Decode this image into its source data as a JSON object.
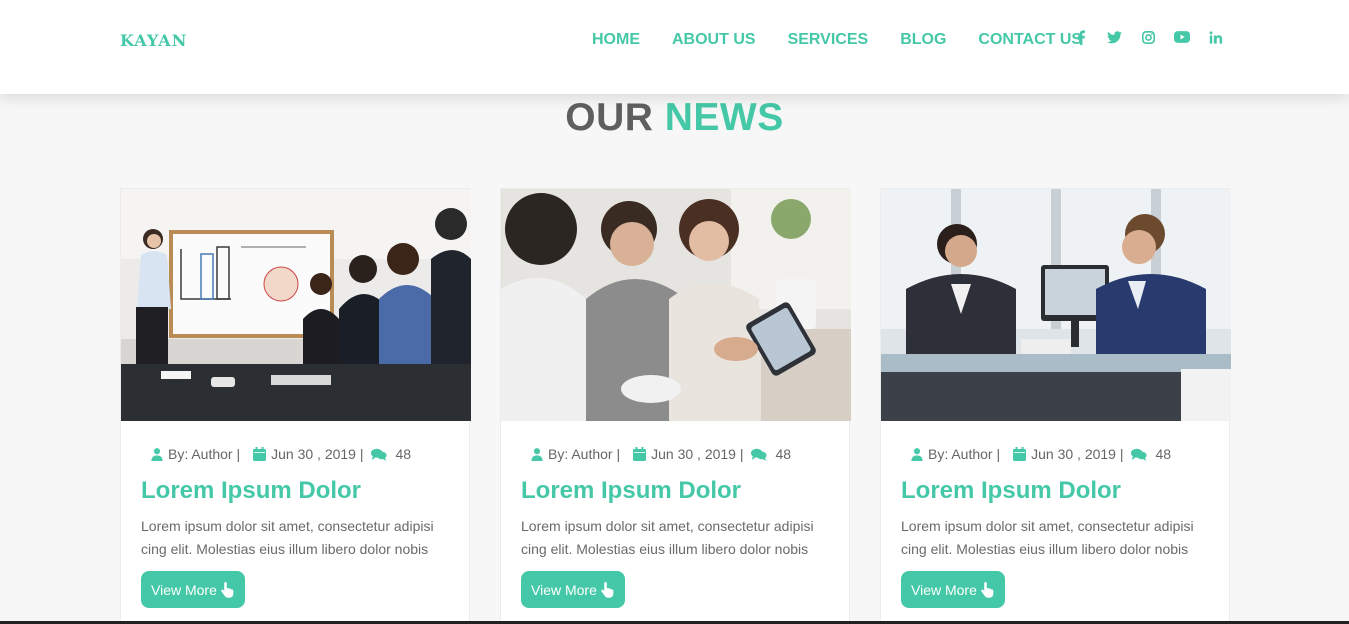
{
  "brand": {
    "logo": "KAYAN",
    "accent_color": "#45c8a7"
  },
  "nav": {
    "links": [
      "HOME",
      "ABOUT US",
      "SERVICES",
      "BLOG",
      "CONTACT US"
    ],
    "socials": [
      "facebook-icon",
      "twitter-icon",
      "instagram-icon",
      "youtube-icon",
      "linkedin-icon"
    ]
  },
  "section": {
    "title_main": "OUR",
    "title_accent": "NEWS"
  },
  "cards": [
    {
      "image": "presentation-whiteboard-meeting",
      "author": "By: Author |",
      "date": "Jun 30 , 2019 |",
      "comments": "48",
      "title": "Lorem Ipsum Dolor",
      "text": "Lorem ipsum dolor sit amet, consectetur adipisi cing elit. Molestias eius illum libero dolor nobis",
      "button": "View More"
    },
    {
      "image": "team-reviewing-tablet",
      "author": "By: Author |",
      "date": "Jun 30 , 2019 |",
      "comments": "48",
      "title": "Lorem Ipsum Dolor",
      "text": "Lorem ipsum dolor sit amet, consectetur adipisi cing elit. Molestias eius illum libero dolor nobis",
      "button": "View More"
    },
    {
      "image": "business-meeting-at-desk",
      "author": "By: Author |",
      "date": "Jun 30 , 2019 |",
      "comments": "48",
      "title": "Lorem Ipsum Dolor",
      "text": "Lorem ipsum dolor sit amet, consectetur adipisi cing elit. Molestias eius illum libero dolor nobis",
      "button": "View More"
    }
  ]
}
